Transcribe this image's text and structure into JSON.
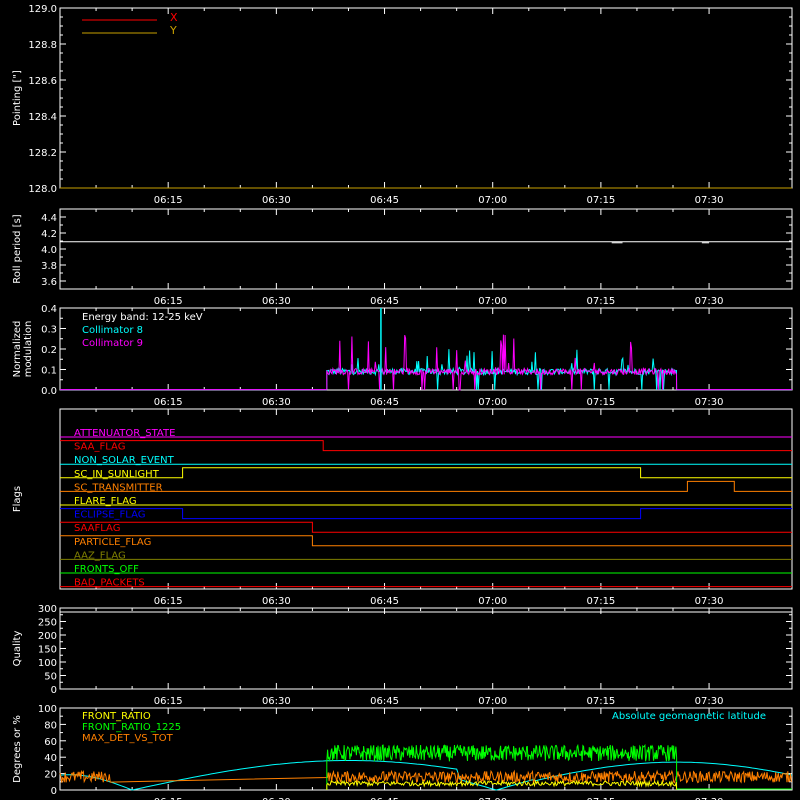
{
  "chart_data": [
    {
      "type": "line",
      "ylabel": "Pointing [\"]",
      "ylim": [
        128.0,
        129.0
      ],
      "yticks": [
        "128.0",
        "128.2",
        "128.4",
        "128.6",
        "128.8",
        "129.0"
      ],
      "xticks": [
        "06:15",
        "06:30",
        "06:45",
        "07:00",
        "07:15",
        "07:30"
      ],
      "legend": {
        "position": "top-left",
        "entries": [
          "X",
          "Y"
        ]
      },
      "series": [
        {
          "name": "X",
          "color": "#ff0000",
          "values": []
        },
        {
          "name": "Y",
          "color": "#c8a000",
          "values": [
            128.0,
            128.0
          ]
        }
      ]
    },
    {
      "type": "line",
      "ylabel": "Roll period [s]",
      "ylim": [
        3.5,
        4.5
      ],
      "yticks": [
        "3.6",
        "3.8",
        "4.0",
        "4.2",
        "4.4"
      ],
      "xticks": [
        "06:15",
        "06:30",
        "06:45",
        "07:00",
        "07:15",
        "07:30"
      ],
      "series": [
        {
          "name": "",
          "color": "#ffffff",
          "values": [
            4.09,
            4.09
          ]
        }
      ]
    },
    {
      "type": "line",
      "ylabel": "Normalized modulation",
      "ylim": [
        0.0,
        0.4
      ],
      "yticks": [
        "0.0",
        "0.1",
        "0.2",
        "0.3",
        "0.4"
      ],
      "xticks": [
        "06:15",
        "06:30",
        "06:45",
        "07:00",
        "07:15",
        "07:30"
      ],
      "annotation": "Energy band: 12-25 keV",
      "legend": {
        "position": "top-left",
        "entries": [
          "Collimator 8",
          "Collimator 9"
        ]
      },
      "series": [
        {
          "name": "Collimator 8",
          "color": "#00ffff",
          "time_range": [
            "06:37",
            "07:25"
          ],
          "typical": 0.09,
          "max": 0.4
        },
        {
          "name": "Collimator 9",
          "color": "#ff00ff",
          "time_range": [
            "06:37",
            "07:25"
          ],
          "typical": 0.09,
          "max": 0.28
        }
      ]
    },
    {
      "type": "line",
      "ylabel": "Flags",
      "xticks": [
        "06:15",
        "06:30",
        "06:45",
        "07:00",
        "07:15",
        "07:30"
      ],
      "flags": [
        {
          "name": "ATTENUATOR_STATE",
          "color": "#ff00ff",
          "state": [
            [
              0,
              0
            ]
          ]
        },
        {
          "name": "SAA_FLAG",
          "color": "#ff0000",
          "state": [
            [
              0,
              1
            ],
            [
              36.5,
              0
            ]
          ]
        },
        {
          "name": "NON_SOLAR_EVENT",
          "color": "#00ffff",
          "state": [
            [
              0,
              0
            ]
          ]
        },
        {
          "name": "SC_IN_SUNLIGHT",
          "color": "#ffff00",
          "state": [
            [
              0,
              0
            ],
            [
              17,
              1
            ],
            [
              80.5,
              0
            ]
          ]
        },
        {
          "name": "SC_TRANSMITTER",
          "color": "#ff8000",
          "state": [
            [
              0,
              0
            ],
            [
              87,
              1
            ],
            [
              93.5,
              0
            ]
          ]
        },
        {
          "name": "FLARE_FLAG",
          "color": "#ffff00",
          "state": [
            [
              0,
              0
            ]
          ]
        },
        {
          "name": "ECLIPSE_FLAG",
          "color": "#0000ff",
          "state": [
            [
              0,
              1
            ],
            [
              17,
              0
            ],
            [
              80.5,
              1
            ]
          ]
        },
        {
          "name": "SAAFLAG",
          "color": "#ff0000",
          "state": [
            [
              0,
              1
            ],
            [
              35,
              0
            ]
          ]
        },
        {
          "name": "PARTICLE_FLAG",
          "color": "#ff8000",
          "state": [
            [
              0,
              1
            ],
            [
              35,
              0
            ]
          ]
        },
        {
          "name": "AAZ_FLAG",
          "color": "#808000",
          "state": [
            [
              0,
              0
            ]
          ]
        },
        {
          "name": "FRONTS_OFF",
          "color": "#00ff00",
          "state": [
            [
              0,
              0
            ]
          ]
        },
        {
          "name": "BAD_PACKETS",
          "color": "#ff0000",
          "state": [
            [
              0,
              0
            ]
          ]
        }
      ]
    },
    {
      "type": "line",
      "ylabel": "Quality",
      "ylim": [
        0,
        300
      ],
      "yticks": [
        "0",
        "50",
        "100",
        "150",
        "200",
        "250",
        "300"
      ],
      "xticks": [
        "06:15",
        "06:30",
        "06:45",
        "07:00",
        "07:15",
        "07:30"
      ],
      "series": [
        {
          "name": "",
          "color": "#ffffff",
          "values": [
            300,
            300
          ]
        }
      ]
    },
    {
      "type": "line",
      "ylabel": "Degrees or %",
      "ylim": [
        0,
        100
      ],
      "yticks": [
        "0",
        "20",
        "40",
        "60",
        "80",
        "100"
      ],
      "xticks": [
        "06:15",
        "06:30",
        "06:45",
        "07:00",
        "07:15",
        "07:30"
      ],
      "legend": {
        "position": "top-left",
        "entries": [
          "FRONT_RATIO",
          "FRONT_RATIO_1225",
          "MAX_DET_VS_TOT"
        ]
      },
      "annotation": "Absolute geomagnetic latitude",
      "series": [
        {
          "name": "FRONT_RATIO",
          "color": "#ffff00",
          "time_range": [
            "06:37",
            "07:25"
          ],
          "typical": 8
        },
        {
          "name": "FRONT_RATIO_1225",
          "color": "#00ff00",
          "time_range": [
            "06:37",
            "07:25"
          ],
          "typical": 45
        },
        {
          "name": "MAX_DET_VS_TOT",
          "color": "#ff8000",
          "typical": 18
        },
        {
          "name": "Absolute geomagnetic latitude",
          "color": "#00ffff",
          "range": [
            0,
            40
          ]
        }
      ]
    }
  ]
}
